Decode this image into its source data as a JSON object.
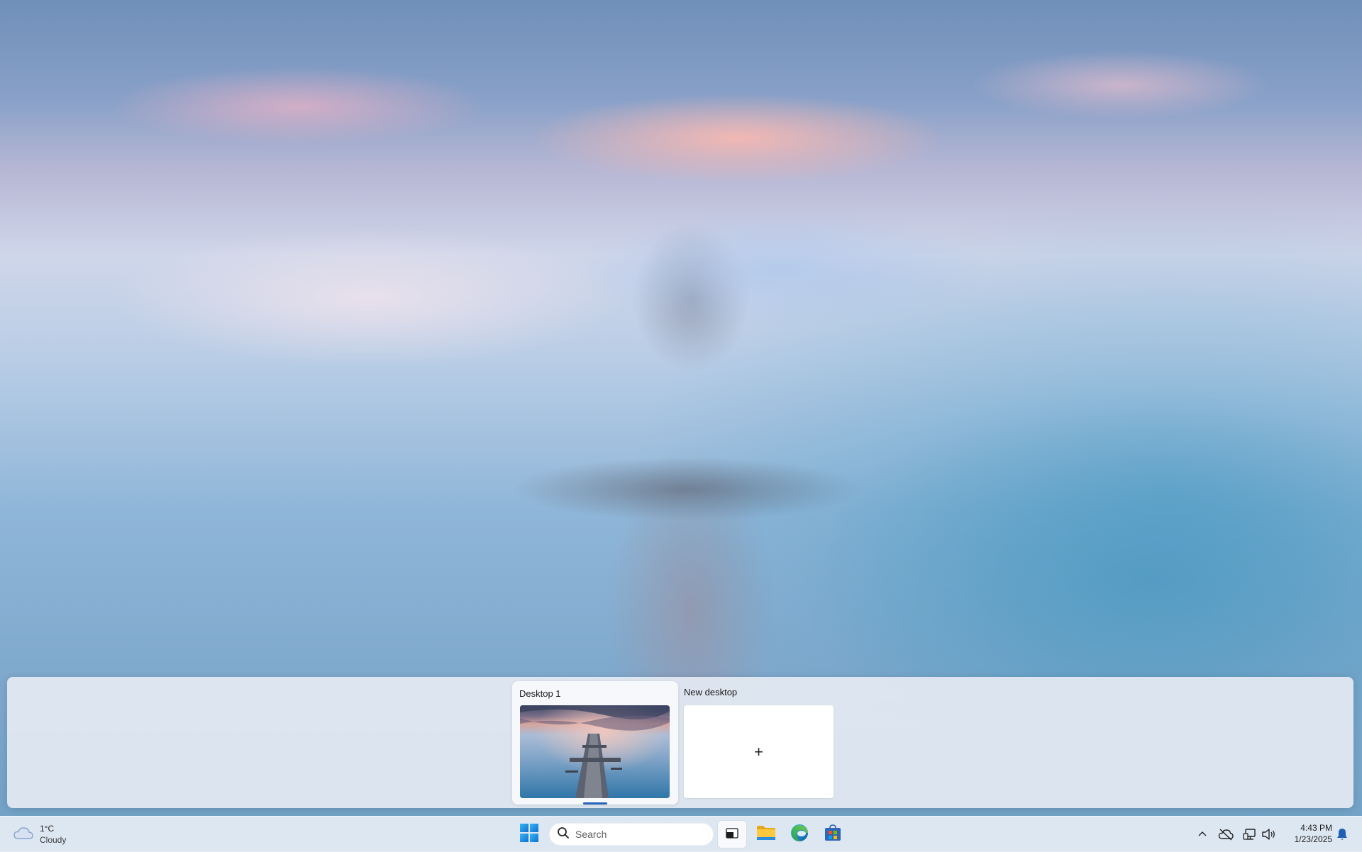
{
  "wallpaper": {
    "description_colors": {
      "sky": "#8aa1c8",
      "glow": "#f6b8b2",
      "water": "#4d9ac2"
    }
  },
  "task_view": {
    "desktops": [
      {
        "label": "Desktop 1",
        "active": true
      }
    ],
    "new_desktop": {
      "label": "New desktop",
      "plus": "+"
    },
    "accent_color": "#2564b8"
  },
  "taskbar": {
    "weather": {
      "icon": "cloud-icon",
      "temperature": "1°C",
      "condition": "Cloudy"
    },
    "start": {
      "icon": "windows-logo-icon"
    },
    "search": {
      "placeholder": "Search",
      "icon": "search-icon"
    },
    "pinned": [
      {
        "name": "task-view",
        "icon": "task-view-icon",
        "pressed": true
      },
      {
        "name": "file-explorer",
        "icon": "folder-icon"
      },
      {
        "name": "microsoft-edge",
        "icon": "edge-icon"
      },
      {
        "name": "microsoft-store",
        "icon": "store-icon"
      }
    ],
    "tray": {
      "icons": [
        "chevron-up-icon",
        "cloud-off-icon",
        "network-icon",
        "volume-icon"
      ]
    },
    "clock": {
      "time": "4:43 PM",
      "date": "1/23/2025"
    },
    "notification_icon": "bell-icon"
  }
}
